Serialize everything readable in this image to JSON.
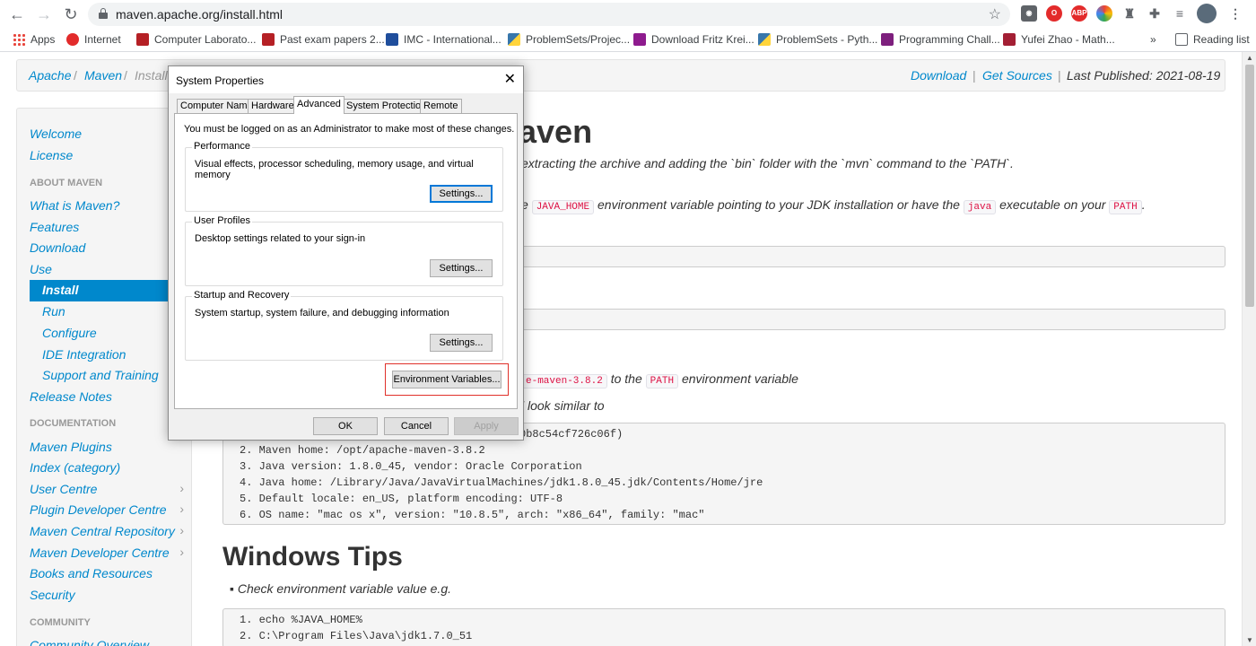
{
  "browser": {
    "url": "maven.apache.org/install.html",
    "bookmarks": [
      {
        "label": "Apps",
        "icon": "apps-grid-icon"
      },
      {
        "label": "Internet",
        "icon": "huawei-icon",
        "color": "#e22b2b"
      },
      {
        "label": "Computer Laborato...",
        "icon": "crest-icon",
        "color": "#b52025"
      },
      {
        "label": "Past exam papers 2...",
        "icon": "crest-icon",
        "color": "#b52025"
      },
      {
        "label": "IMC - International...",
        "icon": "imc-icon",
        "color": "#1f4e9c"
      },
      {
        "label": "ProblemSets/Projec...",
        "icon": "python-icon",
        "color": "#3776ab"
      },
      {
        "label": "Download Fritz Krei...",
        "icon": "download-icon",
        "color": "#8e1b8e"
      },
      {
        "label": "ProblemSets - Pyth...",
        "icon": "python-icon",
        "color": "#3776ab"
      },
      {
        "label": "Programming Chall...",
        "icon": "uva-icon",
        "color": "#7d1f7d"
      },
      {
        "label": "Yufei Zhao - Math...",
        "icon": "mit-icon",
        "color": "#a31f34"
      }
    ],
    "more_bookmarks": "»",
    "reading_list": "Reading list"
  },
  "breadcrumb": {
    "items": [
      "Apache",
      "Maven",
      "Install"
    ],
    "separator": "/",
    "download": "Download",
    "get_sources": "Get Sources",
    "last_published": "Last Published: 2021-08-19"
  },
  "sidebar": {
    "welcome": "Welcome",
    "license": "License",
    "about_header": "ABOUT MAVEN",
    "what_is_maven": "What is Maven?",
    "features": "Features",
    "download": "Download",
    "use": "Use",
    "install": "Install",
    "run": "Run",
    "configure": "Configure",
    "ide_integration": "IDE Integration",
    "support_training": "Support and Training",
    "release_notes": "Release Notes",
    "documentation_header": "DOCUMENTATION",
    "maven_plugins": "Maven Plugins",
    "index_category": "Index (category)",
    "user_centre": "User Centre",
    "plugin_dev_centre": "Plugin Developer Centre",
    "central_repo": "Maven Central Repository",
    "maven_dev_centre": "Maven Developer Centre",
    "books_resources": "Books and Resources",
    "security": "Security",
    "community_header": "COMMUNITY",
    "community_overview": "Community Overview"
  },
  "content": {
    "heading_fragment": "aven",
    "intro_fragment": "extracting the archive and adding the `bin` folder with the `mvn` command to the `PATH`.",
    "req_prefix": "e",
    "java_home": "JAVA_HOME",
    "req_mid": "environment variable pointing to your JDK installation or have the",
    "java": "java",
    "req_end": "executable on your",
    "path": "PATH",
    "period": ".",
    "step_code": "e-maven-3.8.2",
    "step_mid": "to the",
    "step_path": "PATH",
    "step_end": "environment variable",
    "look_similar": "l look similar to",
    "code_lines": [
      {
        "num": "",
        "text": "0b8c54cf726c06f)"
      },
      {
        "num": "2.",
        "text": "Maven home: /opt/apache-maven-3.8.2"
      },
      {
        "num": "3.",
        "text": "Java version: 1.8.0_45, vendor: Oracle Corporation"
      },
      {
        "num": "4.",
        "text": "Java home: /Library/Java/JavaVirtualMachines/jdk1.8.0_45.jdk/Contents/Home/jre"
      },
      {
        "num": "5.",
        "text": "Default locale: en_US, platform encoding: UTF-8"
      },
      {
        "num": "6.",
        "text": "OS name: \"mac os x\", version: \"10.8.5\", arch: \"x86_64\", family: \"mac\""
      }
    ],
    "windows_tips": "Windows Tips",
    "bullet_text": "Check environment variable value e.g.",
    "win_code": [
      {
        "num": "1.",
        "text": "echo %JAVA_HOME%"
      },
      {
        "num": "2.",
        "text": "C:\\Program Files\\Java\\jdk1.7.0_51"
      }
    ]
  },
  "dialog": {
    "title": "System Properties",
    "close": "✕",
    "tabs": [
      "Computer Name",
      "Hardware",
      "Advanced",
      "System Protection",
      "Remote"
    ],
    "admin_note": "You must be logged on as an Administrator to make most of these changes.",
    "performance": {
      "title": "Performance",
      "desc": "Visual effects, processor scheduling, memory usage, and virtual memory",
      "button": "Settings..."
    },
    "user_profiles": {
      "title": "User Profiles",
      "desc": "Desktop settings related to your sign-in",
      "button": "Settings..."
    },
    "startup": {
      "title": "Startup and Recovery",
      "desc": "System startup, system failure, and debugging information",
      "button": "Settings..."
    },
    "env_button": "Environment Variables...",
    "ok": "OK",
    "cancel": "Cancel",
    "apply": "Apply"
  }
}
